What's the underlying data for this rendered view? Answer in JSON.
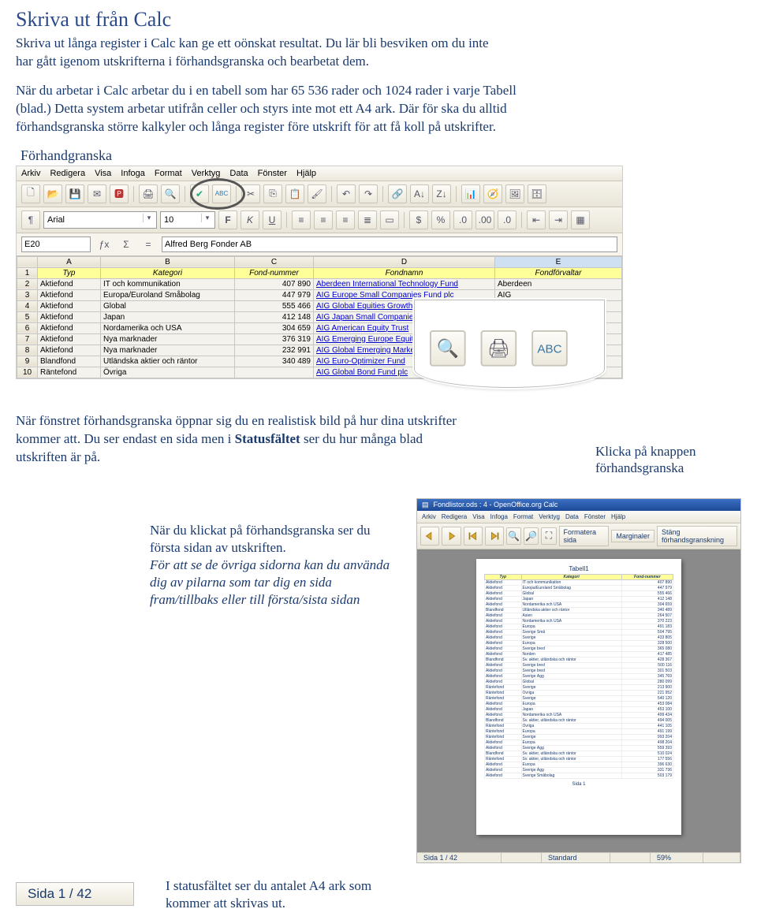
{
  "title": "Skriva ut från Calc",
  "intro1": "Skriva ut långa register i Calc kan ge ett oönskat resultat. Du lär bli besviken om du inte har gått igenom utskrifterna i förhandsgranska och bearbetat dem.",
  "intro2": "När du arbetar i Calc arbetar du i en tabell som har 65 536 rader och 1024 rader i varje Tabell (blad.) Detta system arbetar utifrån celler och styrs inte mot ett A4 ark. Där för ska du alltid förhandsgranska större kalkyler och långa register före utskrift för att få koll på utskrifter.",
  "section1_label": "Förhandgranska",
  "menubar": [
    "Arkiv",
    "Redigera",
    "Visa",
    "Infoga",
    "Format",
    "Verktyg",
    "Data",
    "Fönster",
    "Hjälp"
  ],
  "font_name": "Arial",
  "font_size": "10",
  "cell_ref": "E20",
  "formula_value": "Alfred Berg Fonder AB",
  "col_headers": [
    "A",
    "B",
    "C",
    "D",
    "E"
  ],
  "row1": [
    "Typ",
    "Kategori",
    "Fond-nummer",
    "Fondnamn",
    "Fondförvaltar"
  ],
  "rows": [
    [
      "Aktiefond",
      "IT och kommunikation",
      "407 890",
      "Aberdeen International Technology Fund",
      "Aberdeen"
    ],
    [
      "Aktiefond",
      "Europa/Euroland Småbolag",
      "447 979",
      "AIG Europe Small Companies Fund plc",
      "AIG"
    ],
    [
      "Aktiefond",
      "Global",
      "555 466",
      "AIG Global Equities Growth Fund plc",
      ""
    ],
    [
      "Aktiefond",
      "Japan",
      "412 148",
      "AIG Japan Small Companies Fund plc",
      ""
    ],
    [
      "Aktiefond",
      "Nordamerika och USA",
      "304 659",
      "AIG American Equity Trust",
      ""
    ],
    [
      "Aktiefond",
      "Nya marknader",
      "376 319",
      "AIG Emerging Europe Equity Fund plc",
      ""
    ],
    [
      "Aktiefond",
      "Nya marknader",
      "232 991",
      "AIG Global Emerging Markets Fund plc",
      ""
    ],
    [
      "Blandfond",
      "Utländska aktier och räntor",
      "340 489",
      "AIG Euro-Optimizer Fund",
      ""
    ],
    [
      "Räntefond",
      "Övriga",
      "",
      "AIG Global Bond Fund plc",
      ""
    ]
  ],
  "side_note": "Klicka på knappen förhandsgranska",
  "para2": "När fönstret förhandsgranska öppnar sig du en realistisk bild på hur dina utskrifter kommer att. Du ser endast en sida men i Statusfältet ser du hur många blad utskriften är på.",
  "caption2_line1": "När du klickat på förhandsgranska ser du första sidan av utskriften.",
  "caption2_line2": "För att se de övriga sidorna kan du använda dig av pilarna som tar dig en sida fram/tillbaks eller till första/sista sidan",
  "preview_titlebar": "Fondlistor.ods : 4 - OpenOffice.org Calc",
  "preview_menubar": [
    "Arkiv",
    "Redigera",
    "Visa",
    "Infoga",
    "Format",
    "Verktyg",
    "Data",
    "Fönster",
    "Hjälp"
  ],
  "preview_btn_format": "Formatera sida",
  "preview_btn_margins": "Marginaler",
  "preview_btn_close": "Stäng förhandsgranskning",
  "paper_title": "Tabell1",
  "paper_headers": [
    "Typ",
    "Kategori",
    "Fond-nummer"
  ],
  "paper_rows": [
    [
      "Aktiefond",
      "IT och kommunikation",
      "407 890"
    ],
    [
      "Aktiefond",
      "Europa/Euroland Småbolag",
      "447 979"
    ],
    [
      "Aktiefond",
      "Global",
      "555 466"
    ],
    [
      "Aktiefond",
      "Japan",
      "412 148"
    ],
    [
      "Aktiefond",
      "Nordamerika och USA",
      "304 659"
    ],
    [
      "Blandfond",
      "Utländska aktier och räntor",
      "340 489"
    ],
    [
      "Aktiefond",
      "Asien",
      "264 507"
    ],
    [
      "Aktiefond",
      "Nordamerika och USA",
      "370 223"
    ],
    [
      "Aktiefond",
      "Europa",
      "491 183"
    ],
    [
      "Aktiefond",
      "Sverige Små",
      "504 795"
    ],
    [
      "Aktiefond",
      "Sverige",
      "433 805"
    ],
    [
      "Aktiefond",
      "Europa",
      "328 500"
    ],
    [
      "Aktiefond",
      "Sverige bred",
      "365 080"
    ],
    [
      "Aktiefond",
      "Norden",
      "417 485"
    ],
    [
      "Blandfond",
      "Sv. aktier, utländska och räntor",
      "428 367"
    ],
    [
      "Aktiefond",
      "Sverige bred",
      "500 116"
    ],
    [
      "Aktiefond",
      "Sverige bred",
      "301 503"
    ],
    [
      "Aktiefond",
      "Sverige Ägg",
      "345 769"
    ],
    [
      "Aktiefond",
      "Global",
      "280 099"
    ],
    [
      "Räntefond",
      "Sverige",
      "213 900"
    ],
    [
      "Räntefond",
      "Övriga",
      "221 952"
    ],
    [
      "Räntefond",
      "Sverige",
      "540 120"
    ],
    [
      "Aktiefond",
      "Europa",
      "453 084"
    ],
    [
      "Aktiefond",
      "Japan",
      "453 100"
    ],
    [
      "Aktiefond",
      "Nordamerika och USA",
      "499 434"
    ],
    [
      "Blandfond",
      "Sv. aktier, utländska och räntor",
      "494 005"
    ],
    [
      "Räntefond",
      "Övriga",
      "441 105"
    ],
    [
      "Räntefond",
      "Europa",
      "491 199"
    ],
    [
      "Räntefond",
      "Sverige",
      "993 204"
    ],
    [
      "Aktiefond",
      "Europa",
      "498 204"
    ],
    [
      "Aktiefond",
      "Sverige Ägg",
      "559 393"
    ],
    [
      "Blandfond",
      "Sv. aktier, utländska och räntor",
      "510 024"
    ],
    [
      "Räntefond",
      "Sv. aktier, utländska och räntor",
      "177 556"
    ],
    [
      "Aktiefond",
      "Europa",
      "396 630"
    ],
    [
      "Aktiefond",
      "Sverige Ägg",
      "331 736"
    ],
    [
      "Aktiefond",
      "Sverige Småbolag",
      "503 179"
    ]
  ],
  "paper_pagenum": "Sida 1",
  "status_page": "Sida 1 / 42",
  "status_std": "Standard",
  "status_zoom": "59%",
  "sida_badge": "Sida 1 / 42",
  "caption3": "I statusfältet ser du antalet A4 ark som kommer att skrivas ut.",
  "bold_word": "Statusfältet"
}
